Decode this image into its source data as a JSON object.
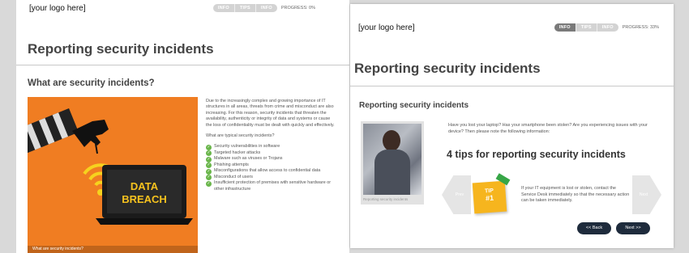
{
  "left": {
    "logo": "[your logo here]",
    "nav": {
      "info": "INFO",
      "tips": "TIPS",
      "info2": "INFO",
      "progress": "PROGRESS: 0%"
    },
    "title": "Reporting security incidents",
    "section_title": "What are security incidents?",
    "image": {
      "breach_line1": "DATA",
      "breach_line2": "BREACH",
      "caption": "What are security incidents?"
    },
    "paragraph": "Due to the increasingly complex and growing importance of IT structures in all areas, threats from crime and misconduct are also increasing. For this reason, security incidents that threaten the availability, authenticity or integrity of data and systems or cause the loss of confidentiality must be dealt with quickly and effectively.",
    "list_heading": "What are typical security incidents?",
    "list": [
      "Security vulnerabilities in software",
      "Targeted hacker attacks",
      "Malware such as viruses or Trojans",
      "Phishing attempts",
      "Misconfigurations that allow access to confidential data",
      "Misconduct of users",
      "Insufficient protection of premises with sensitive hardware or other infrastructure"
    ]
  },
  "right": {
    "logo": "[your logo here]",
    "nav": {
      "info": "INFO",
      "tips": "TIPS",
      "info2": "INFO",
      "progress": "PROGRESS: 33%"
    },
    "title": "Reporting security incidents",
    "section_title": "Reporting security incidents",
    "intro": "Have you lost your laptop? Has your smartphone been stolen? Are you experiencing issues with your device? Then please note the following information:",
    "tips_title": "4 tips for reporting security incidents",
    "photo_caption": "Reporting security incidents",
    "prev_label": "Prev",
    "next_arrow_label": "Next",
    "tip_card": {
      "line1": "TIP",
      "line2": "#1"
    },
    "tip_text": "If your IT equipment is lost or stolen, contact the Service Desk immediately so that the necessary action can be taken immediately.",
    "back_button": "<< Back",
    "next_button": "Next >>"
  },
  "colors": {
    "orange": "#f07d22",
    "check_green": "#6ab64b",
    "tip_yellow": "#f6b51e",
    "button_navy": "#1e2b3c"
  }
}
